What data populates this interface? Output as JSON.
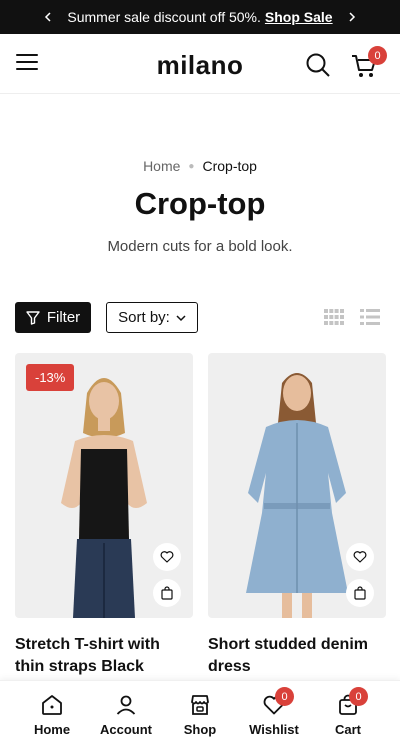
{
  "announcement": {
    "text": "Summer sale discount off 50%.",
    "link_label": "Shop Sale"
  },
  "header": {
    "logo": "milano",
    "cart_count": "0"
  },
  "breadcrumb": {
    "home": "Home",
    "current": "Crop-top"
  },
  "page": {
    "title": "Crop-top",
    "subtitle": "Modern cuts for a bold look."
  },
  "toolbar": {
    "filter_label": "Filter",
    "sort_label": "Sort by:"
  },
  "products": [
    {
      "name": "Stretch T-shirt with thin straps Black",
      "badge": "-13%"
    },
    {
      "name": "Short studded denim dress",
      "badge": ""
    }
  ],
  "bottom_nav": [
    {
      "label": "Home",
      "icon": "home-icon"
    },
    {
      "label": "Account",
      "icon": "user-icon"
    },
    {
      "label": "Shop",
      "icon": "shop-icon"
    },
    {
      "label": "Wishlist",
      "icon": "heart-icon",
      "count": "0"
    },
    {
      "label": "Cart",
      "icon": "bag-icon",
      "count": "0"
    }
  ],
  "colors": {
    "accent": "#d9413a",
    "dark": "#111111",
    "card_bg": "#efefef"
  }
}
